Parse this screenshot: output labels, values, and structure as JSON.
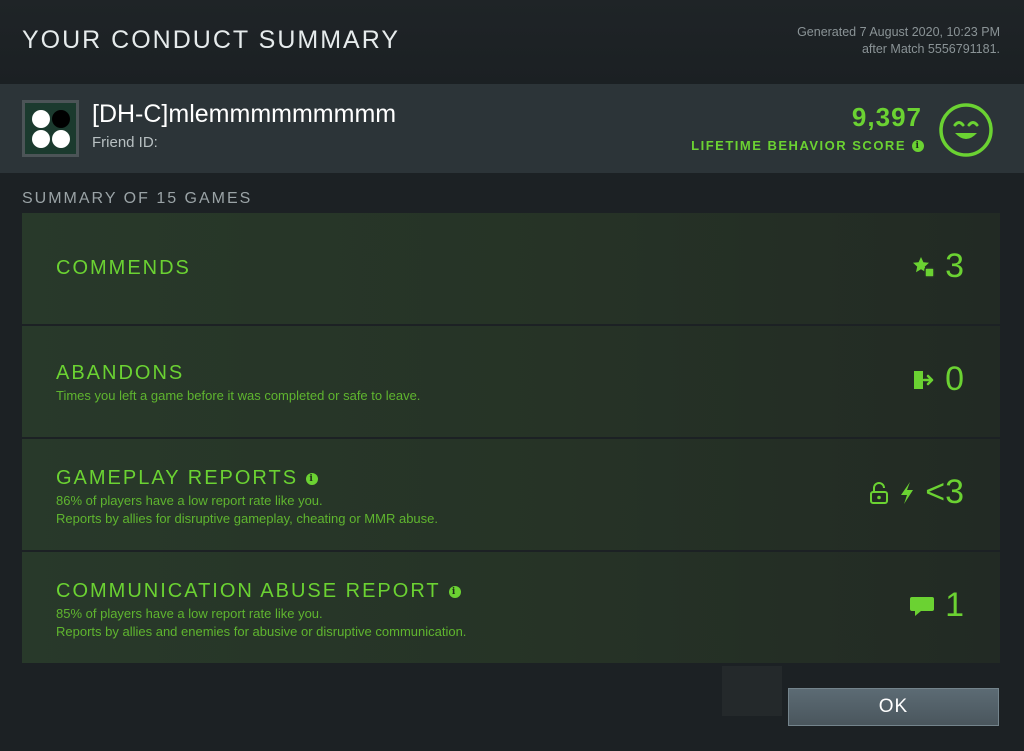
{
  "header": {
    "title": "YOUR CONDUCT SUMMARY",
    "generated_line1": "Generated 7 August 2020, 10:23 PM",
    "generated_line2": "after Match 5556791181."
  },
  "player": {
    "name": "[DH-C]mlemmmmmmmmm",
    "friend_id_label": "Friend ID:",
    "score": "9,397",
    "score_label": "LIFETIME BEHAVIOR SCORE",
    "info_glyph": "i"
  },
  "summary": {
    "label": "SUMMARY OF 15 GAMES",
    "rows": [
      {
        "title": "COMMENDS",
        "desc1": "",
        "desc2": "",
        "value": "3",
        "icon": "star-thumbs-up-icon"
      },
      {
        "title": "ABANDONS",
        "desc1": "Times you left a game before it was completed or safe to leave.",
        "desc2": "",
        "value": "0",
        "icon": "exit-door-icon"
      },
      {
        "title": "GAMEPLAY REPORTS",
        "desc1": "86% of players have a low report rate like you.",
        "desc2": "Reports by allies for disruptive gameplay, cheating or MMR abuse.",
        "value": "<3",
        "icon": "lock-lightning-icon"
      },
      {
        "title": "COMMUNICATION ABUSE REPORT",
        "desc1": "85% of players have a low report rate like you.",
        "desc2": "Reports by allies and enemies for abusive or disruptive communication.",
        "value": "1",
        "icon": "chat-bubble-icon"
      }
    ]
  },
  "buttons": {
    "ok_label": "OK"
  },
  "colors": {
    "accent_green": "#6bd232",
    "background": "#1c2124",
    "ok_button": "#55636b"
  }
}
